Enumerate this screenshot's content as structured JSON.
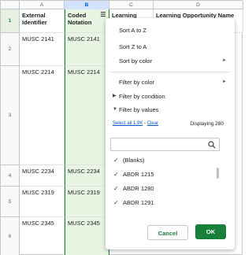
{
  "columns": [
    "A",
    "B",
    "C",
    "D"
  ],
  "row_numbers": [
    "1",
    "2",
    "3",
    "4",
    "5",
    "6"
  ],
  "header_row": {
    "col_a": "External Identifier",
    "col_b": "Coded Notation",
    "col_c": "Learning Type",
    "col_d": "Learning Opportunity Name"
  },
  "rows": [
    {
      "a": "MUSC 2141",
      "b": "MUSC 2141"
    },
    {
      "a": "MUSC 2214",
      "b": "MUSC 2214"
    },
    {
      "a": "MUSC 2234",
      "b": "MUSC 2234"
    },
    {
      "a": "MUSC 2319",
      "b": "MUSC 2319"
    },
    {
      "a": "MUSC 2345",
      "b": "MUSC 2345"
    }
  ],
  "filter_icon": "filter-icon",
  "menu": {
    "sort_a_z": "Sort A to Z",
    "sort_z_a": "Sort Z to A",
    "sort_by_color": "Sort by color",
    "filter_by_color": "Filter by color",
    "filter_by_condition": "Filter by condition",
    "filter_by_values": "Filter by values",
    "select_all": "Select all 1.9K",
    "separator": " - ",
    "clear": "Clear",
    "displaying": "Displaying 280",
    "search_placeholder": "",
    "values": [
      "(Blanks)",
      "ABDR 1215",
      "ABDR 1280",
      "ABDR 1291"
    ],
    "cancel": "Cancel",
    "ok": "OK"
  },
  "colors": {
    "accent_green": "#188038",
    "selected_col_bg": "#e8f5e3",
    "link_blue": "#0b57d0"
  }
}
